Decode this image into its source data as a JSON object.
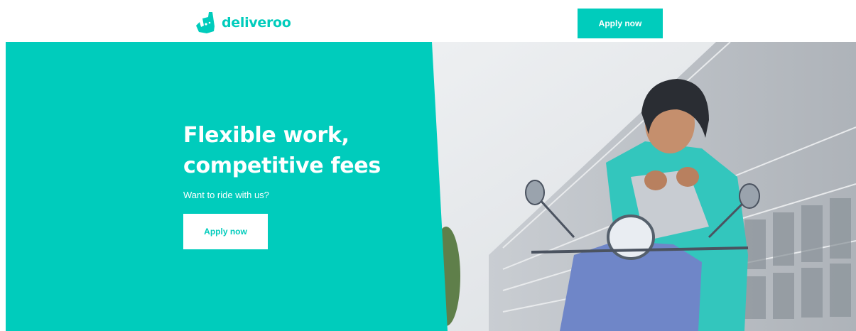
{
  "header": {
    "logo_text": "deliveroo",
    "apply_label": "Apply now"
  },
  "hero": {
    "title_line1": "Flexible work,",
    "title_line2": "competitive fees",
    "subtitle": "Want to ride with us?",
    "apply_label": "Apply now"
  },
  "colors": {
    "brand_teal": "#00ccbc",
    "white": "#ffffff"
  },
  "icons": {
    "logo": "kangaroo-logo-icon"
  }
}
